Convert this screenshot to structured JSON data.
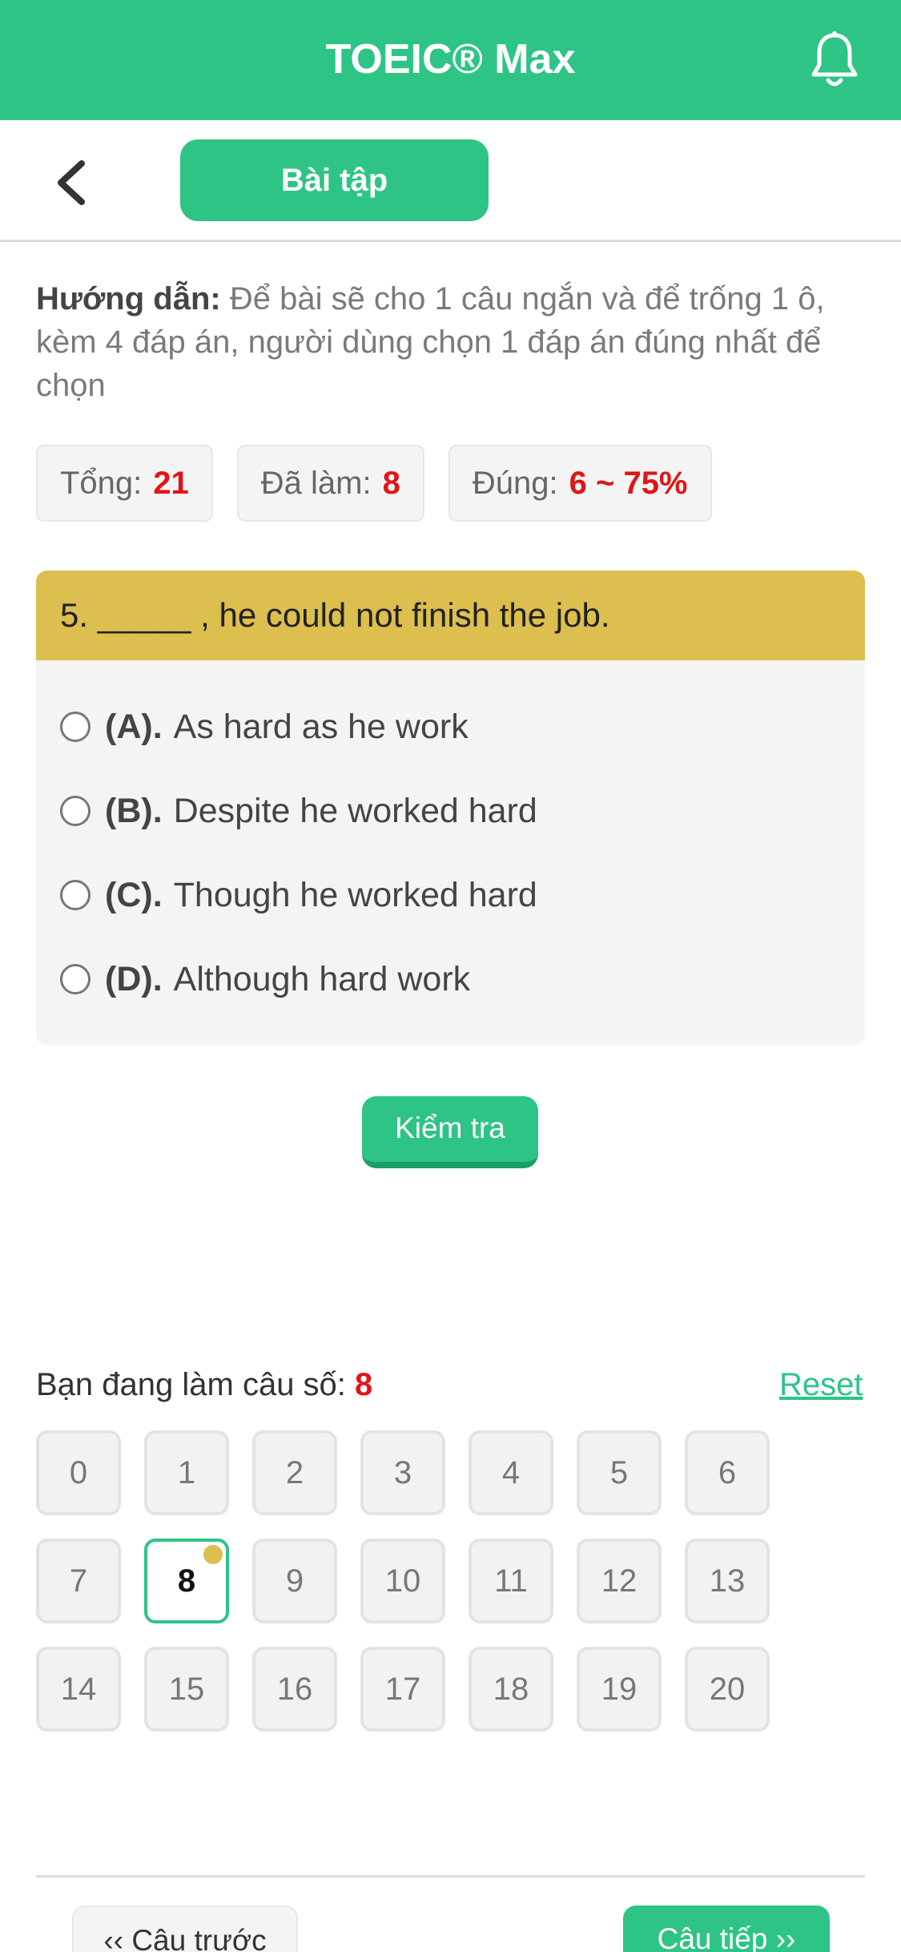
{
  "app": {
    "title": "TOEIC® Max"
  },
  "subbar": {
    "tab_label": "Bài tập"
  },
  "guide": {
    "label": "Hướng dẫn:",
    "text": "Để bài sẽ cho 1 câu ngắn và để trống 1 ô, kèm 4 đáp án, người dùng chọn 1 đáp án đúng nhất để chọn"
  },
  "stats": [
    {
      "label": "Tổng:",
      "value": "21"
    },
    {
      "label": "Đã làm:",
      "value": "8"
    },
    {
      "label": "Đúng:",
      "value": "6 ~ 75%"
    }
  ],
  "question": {
    "text": "5. _____ , he could not finish the job.",
    "options": [
      {
        "letter": "(A).",
        "text": "As hard as he work"
      },
      {
        "letter": "(B).",
        "text": "Despite he worked hard"
      },
      {
        "letter": "(C).",
        "text": "Though he worked hard"
      },
      {
        "letter": "(D).",
        "text": "Although hard work"
      }
    ]
  },
  "check_label": "Kiểm tra",
  "progress": {
    "label": "Bạn đang làm câu số:",
    "current": "8",
    "reset_label": "Reset"
  },
  "grid": {
    "numbers": [
      "0",
      "1",
      "2",
      "3",
      "4",
      "5",
      "6",
      "7",
      "8",
      "9",
      "10",
      "11",
      "12",
      "13",
      "14",
      "15",
      "16",
      "17",
      "18",
      "19",
      "20"
    ],
    "current_index": 8
  },
  "nav": {
    "prev_label": "‹‹ Câu trước",
    "next_label": "Câu tiếp ››"
  },
  "colors": {
    "brand": "#2ec486",
    "question_header": "#dcbf4e",
    "highlight_value": "#e11515"
  },
  "icons": {
    "notification": "bell-icon",
    "back": "chevron-left-icon"
  }
}
